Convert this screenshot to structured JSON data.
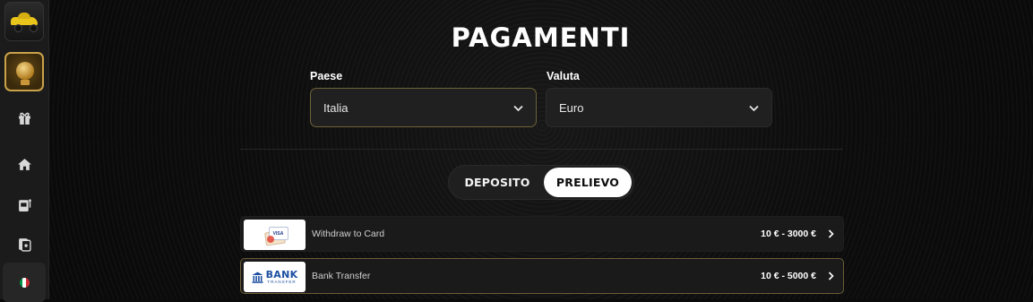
{
  "sidebar": {
    "items": [
      {
        "name": "promo-car",
        "icon": "car-thumbnail"
      },
      {
        "name": "promo-trophy",
        "icon": "trophy-thumbnail"
      },
      {
        "name": "gifts",
        "icon": "gift-icon"
      },
      {
        "name": "home",
        "icon": "home-icon"
      },
      {
        "name": "slots",
        "icon": "slot-machine-icon"
      },
      {
        "name": "cards",
        "icon": "cards-icon"
      }
    ],
    "language_flag": {
      "icon": "italy-flag-icon",
      "colors": [
        "#009246",
        "#ffffff",
        "#ce2b37"
      ]
    }
  },
  "page": {
    "title": "PAGAMENTI",
    "country_label": "Paese",
    "country_value": "Italia",
    "currency_label": "Valuta",
    "currency_value": "Euro"
  },
  "tabs": {
    "deposit": "DEPOSITO",
    "withdraw": "PRELIEVO",
    "active": "PRELIEVO"
  },
  "methods": [
    {
      "name": "Withdraw to Card",
      "range": "10 € - 3000 €",
      "logo": "visa-card-logo",
      "logo_text": "VISA"
    },
    {
      "name": "Bank Transfer",
      "range": "10 € - 5000 €",
      "logo": "bank-transfer-logo",
      "logo_text": "BANK",
      "logo_subtext": "TRANSFER"
    }
  ],
  "colors": {
    "background": "#0b0b0b",
    "sidebar": "#1b1b1b",
    "accent_border": "#6e6237",
    "bank_blue": "#1c4fa0"
  }
}
